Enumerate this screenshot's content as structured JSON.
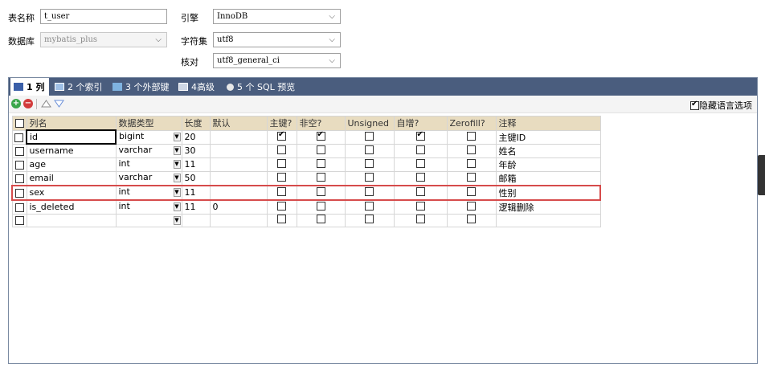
{
  "form": {
    "table_name_label": "表名称",
    "table_name_value": "t_user",
    "database_label": "数据库",
    "database_value": "mybatis_plus",
    "engine_label": "引擎",
    "engine_value": "InnoDB",
    "charset_label": "字符集",
    "charset_value": "utf8",
    "collation_label": "核对",
    "collation_value": "utf8_general_ci"
  },
  "tabs": [
    {
      "label": "1 列"
    },
    {
      "label": "2 个索引"
    },
    {
      "label": "3 个外部键"
    },
    {
      "label": "4高级"
    },
    {
      "label": "5 个 SQL 预览"
    }
  ],
  "toolbar": {
    "hide_comments_label": "隐藏语言选项"
  },
  "columns": {
    "headers": [
      "列名",
      "数据类型",
      "长度",
      "默认",
      "主键?",
      "非空?",
      "Unsigned",
      "自增?",
      "Zerofill?",
      "注释"
    ]
  },
  "rows": [
    {
      "name": "id",
      "type": "bigint",
      "length": "20",
      "default": "",
      "pk": true,
      "notnull": true,
      "unsigned": false,
      "autoinc": true,
      "zerofill": false,
      "comment": "主键ID"
    },
    {
      "name": "username",
      "type": "varchar",
      "length": "30",
      "default": "",
      "pk": false,
      "notnull": false,
      "unsigned": false,
      "autoinc": false,
      "zerofill": false,
      "comment": "姓名"
    },
    {
      "name": "age",
      "type": "int",
      "length": "11",
      "default": "",
      "pk": false,
      "notnull": false,
      "unsigned": false,
      "autoinc": false,
      "zerofill": false,
      "comment": "年龄"
    },
    {
      "name": "email",
      "type": "varchar",
      "length": "50",
      "default": "",
      "pk": false,
      "notnull": false,
      "unsigned": false,
      "autoinc": false,
      "zerofill": false,
      "comment": "邮箱"
    },
    {
      "name": "sex",
      "type": "int",
      "length": "11",
      "default": "",
      "pk": false,
      "notnull": false,
      "unsigned": false,
      "autoinc": false,
      "zerofill": false,
      "comment": "性别"
    },
    {
      "name": "is_deleted",
      "type": "int",
      "length": "11",
      "default": "0",
      "pk": false,
      "notnull": false,
      "unsigned": false,
      "autoinc": false,
      "zerofill": false,
      "comment": "逻辑删除"
    },
    {
      "name": "",
      "type": "",
      "length": "",
      "default": "",
      "pk": false,
      "notnull": false,
      "unsigned": false,
      "autoinc": false,
      "zerofill": false,
      "comment": ""
    }
  ],
  "colors": {
    "tabbar": "#4a5d7e",
    "header": "#e8dcc0",
    "highlight": "#d64b4b",
    "add_button": "#3aa64a",
    "remove_button": "#d23c3c"
  }
}
